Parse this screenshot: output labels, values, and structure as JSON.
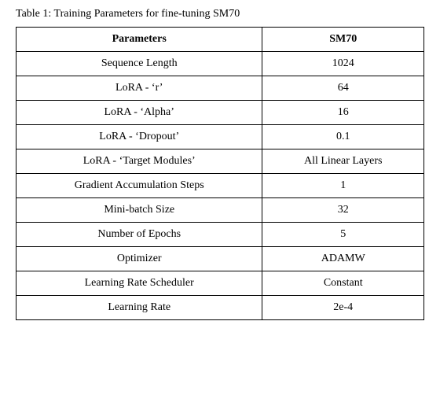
{
  "caption": {
    "text": "Table 1: Training Parameters for fine-tuning SM70"
  },
  "table": {
    "headers": [
      "Parameters",
      "SM70"
    ],
    "rows": [
      [
        "Sequence Length",
        "1024"
      ],
      [
        "LoRA - ‘r’",
        "64"
      ],
      [
        "LoRA - ‘Alpha’",
        "16"
      ],
      [
        "LoRA - ‘Dropout’",
        "0.1"
      ],
      [
        "LoRA - ‘Target Modules’",
        "All Linear Layers"
      ],
      [
        "Gradient Accumulation Steps",
        "1"
      ],
      [
        "Mini-batch Size",
        "32"
      ],
      [
        "Number of Epochs",
        "5"
      ],
      [
        "Optimizer",
        "ADAMW"
      ],
      [
        "Learning Rate Scheduler",
        "Constant"
      ],
      [
        "Learning Rate",
        "2e-4"
      ]
    ]
  }
}
